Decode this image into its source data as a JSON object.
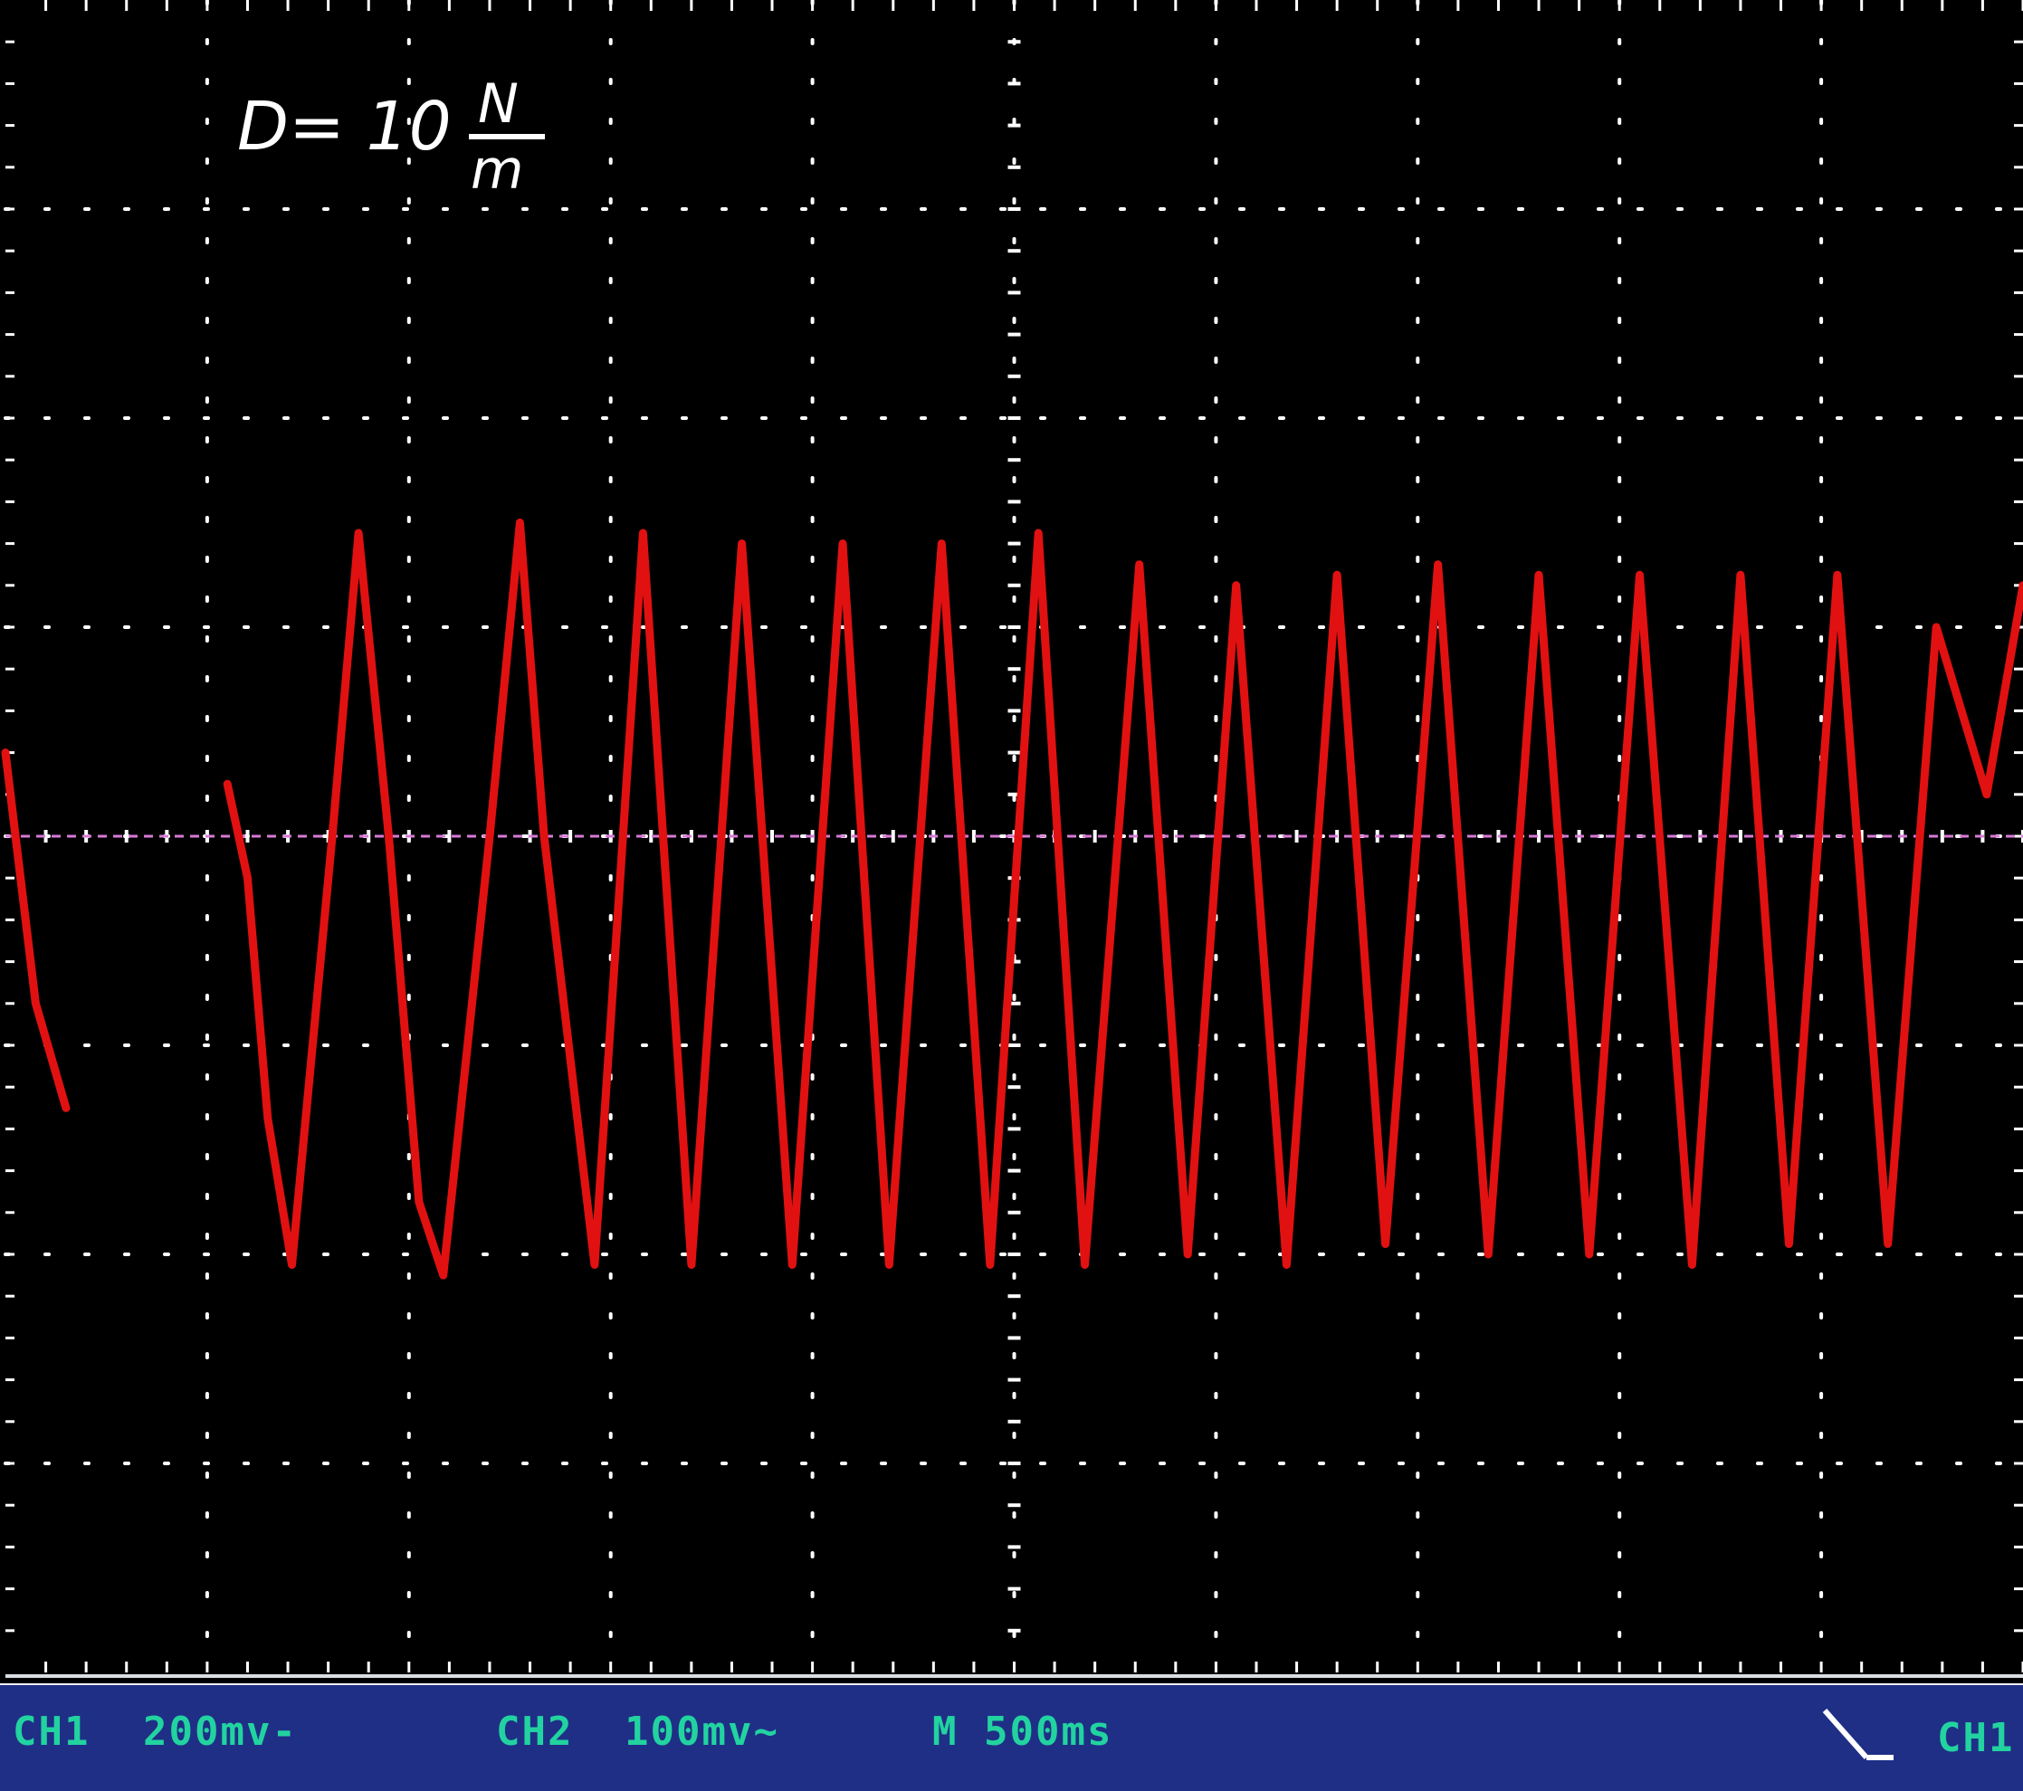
{
  "annotation": {
    "prefix": "D= 10",
    "numerator": "N",
    "denominator": "m"
  },
  "status_bar": {
    "ch1": "CH1",
    "ch1_scale": "200mv-",
    "ch2": "CH2",
    "ch2_scale": "100mv~",
    "timebase": "M 500ms",
    "trigger_channel": "CH1"
  },
  "colors": {
    "background": "#000000",
    "grid": "#ffffff",
    "trace": "#e11111",
    "reference": "#d67ad6",
    "status_bar": "#1f2f86",
    "status_text": "#22d3a0"
  },
  "chart_data": {
    "type": "line",
    "grid": true,
    "grid_divisions": {
      "x": 10,
      "y": 8
    },
    "x_unit": "div",
    "y_unit": "div",
    "xlim": [
      0,
      10
    ],
    "ylim": [
      -4,
      4
    ],
    "series": [
      {
        "x": [
          0.0,
          0.15,
          0.3,
          1.1,
          1.2,
          1.3,
          1.42,
          1.62,
          1.75,
          1.9,
          2.05,
          2.17,
          2.4,
          2.55,
          2.67,
          2.92,
          3.16,
          3.4,
          3.65,
          3.9,
          4.15,
          4.38,
          4.64,
          4.88,
          5.12,
          5.35,
          5.62,
          5.86,
          6.1,
          6.35,
          6.6,
          6.84,
          7.1,
          7.35,
          7.6,
          7.85,
          8.1,
          8.36,
          8.6,
          8.84,
          9.08,
          9.33,
          9.57,
          9.82,
          10.0
        ],
        "y": [
          0.4,
          -0.8,
          -1.3,
          0.25,
          -0.2,
          -1.35,
          -2.05,
          0.0,
          1.45,
          0.0,
          -1.75,
          -2.1,
          0.0,
          1.5,
          0.0,
          -2.05,
          1.45,
          -2.05,
          1.4,
          -2.05,
          1.4,
          -2.05,
          1.4,
          -2.05,
          1.45,
          -2.05,
          1.3,
          -2.0,
          1.2,
          -2.05,
          1.25,
          -1.95,
          1.3,
          -2.0,
          1.25,
          -2.0,
          1.25,
          -2.05,
          1.25,
          -1.95,
          1.25,
          -1.95,
          1.0,
          0.2,
          1.2
        ]
      }
    ]
  }
}
